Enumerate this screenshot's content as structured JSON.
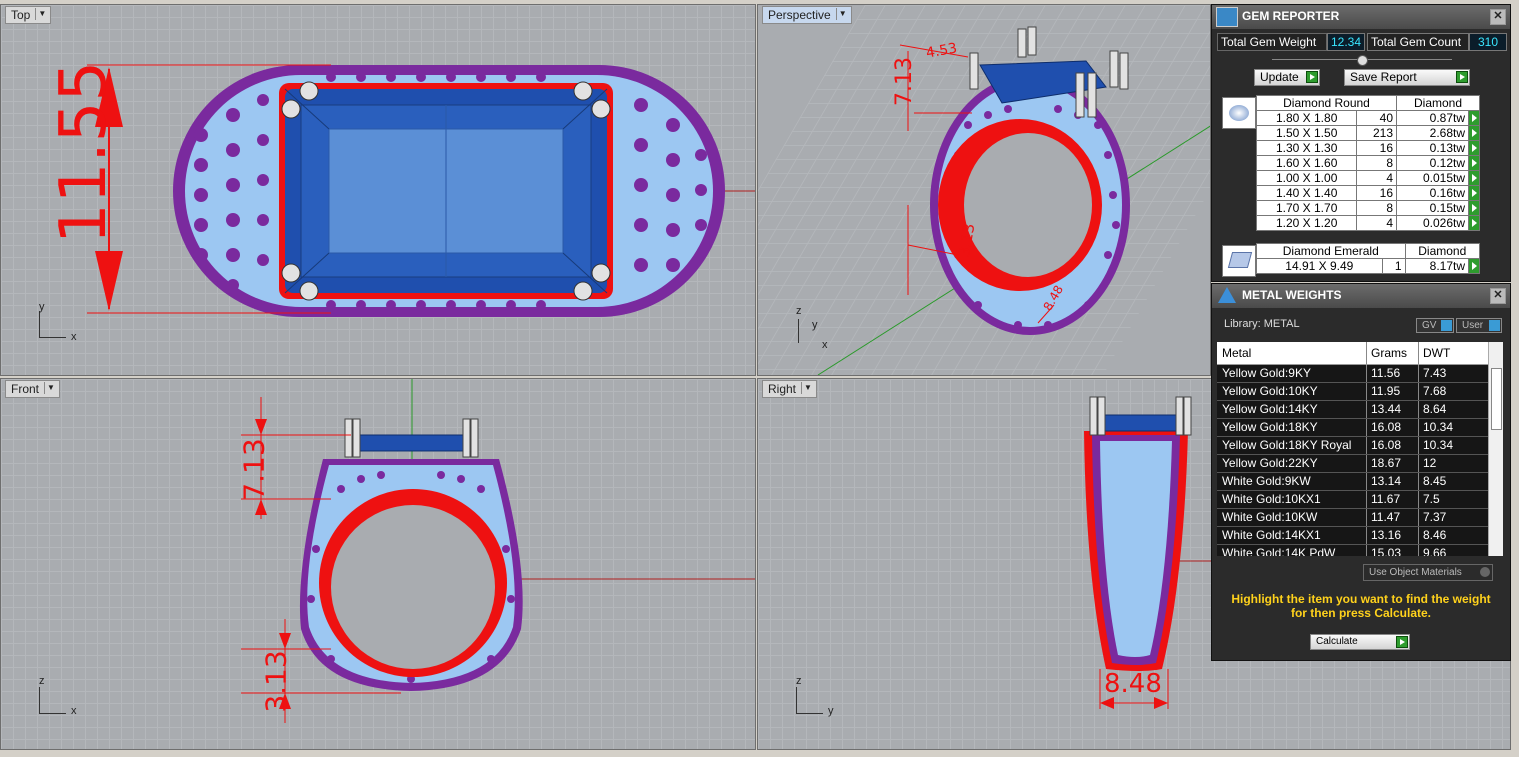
{
  "viewports": {
    "top": {
      "label": "Top",
      "axis_a": "y",
      "axis_b": "x",
      "dim_main": "11.55"
    },
    "perspective": {
      "label": "Perspective",
      "axis_a": "z",
      "axis_b": "y",
      "axis_c": "x",
      "dims": [
        "7.13",
        "4.53",
        "3.13",
        "8.48"
      ]
    },
    "front": {
      "label": "Front",
      "axis_a": "z",
      "axis_b": "x",
      "dim_top": "7.13",
      "dim_bottom": "3.13"
    },
    "right": {
      "label": "Right",
      "axis_a": "z",
      "axis_b": "y",
      "dim_width": "8.48"
    }
  },
  "gem_reporter": {
    "title": "GEM REPORTER",
    "close": "✕",
    "total_weight_label": "Total Gem Weight",
    "total_weight_value": "12.34",
    "total_count_label": "Total Gem Count",
    "total_count_value": "310",
    "update_label": "Update",
    "save_report_label": "Save Report",
    "round_group": {
      "name": "Diamond Round",
      "material": "Diamond",
      "rows": [
        {
          "size": "1.80 X 1.80",
          "count": "40",
          "weight": "0.87tw"
        },
        {
          "size": "1.50 X 1.50",
          "count": "213",
          "weight": "2.68tw"
        },
        {
          "size": "1.30 X 1.30",
          "count": "16",
          "weight": "0.13tw"
        },
        {
          "size": "1.60 X 1.60",
          "count": "8",
          "weight": "0.12tw"
        },
        {
          "size": "1.00 X 1.00",
          "count": "4",
          "weight": "0.015tw"
        },
        {
          "size": "1.40 X 1.40",
          "count": "16",
          "weight": "0.16tw"
        },
        {
          "size": "1.70 X 1.70",
          "count": "8",
          "weight": "0.15tw"
        },
        {
          "size": "1.20 X 1.20",
          "count": "4",
          "weight": "0.026tw"
        }
      ]
    },
    "emerald_group": {
      "name": "Diamond Emerald",
      "material": "Diamond",
      "rows": [
        {
          "size": "14.91 X 9.49",
          "count": "1",
          "weight": "8.17tw"
        }
      ]
    }
  },
  "metal_weights": {
    "title": "METAL WEIGHTS",
    "close": "✕",
    "library_label": "Library: METAL",
    "gv_label": "GV",
    "user_label": "User",
    "col_metal": "Metal",
    "col_grams": "Grams",
    "col_dwt": "DWT",
    "rows": [
      {
        "metal": "Yellow Gold:9KY",
        "grams": "11.56",
        "dwt": "7.43"
      },
      {
        "metal": "Yellow Gold:10KY",
        "grams": "11.95",
        "dwt": "7.68"
      },
      {
        "metal": "Yellow Gold:14KY",
        "grams": "13.44",
        "dwt": "8.64"
      },
      {
        "metal": "Yellow Gold:18KY",
        "grams": "16.08",
        "dwt": "10.34"
      },
      {
        "metal": "Yellow Gold:18KY Royal",
        "grams": "16.08",
        "dwt": "10.34"
      },
      {
        "metal": "Yellow Gold:22KY",
        "grams": "18.67",
        "dwt": "12"
      },
      {
        "metal": "White Gold:9KW",
        "grams": "13.14",
        "dwt": "8.45"
      },
      {
        "metal": "White Gold:10KX1",
        "grams": "11.67",
        "dwt": "7.5"
      },
      {
        "metal": "White Gold:10KW",
        "grams": "11.47",
        "dwt": "7.37"
      },
      {
        "metal": "White Gold:14KX1",
        "grams": "13.16",
        "dwt": "8.46"
      },
      {
        "metal": "White Gold:14K PdW",
        "grams": "15.03",
        "dwt": "9.66"
      }
    ],
    "use_object_materials": "Use Object Materials",
    "hint": "Highlight the item you want to find the weight for then press Calculate.",
    "calculate_label": "Calculate"
  },
  "colors": {
    "accent_red": "#ee1111",
    "gem_blue": "#1f4fae",
    "pave_purple": "#7a2a9e",
    "hint_yellow": "#ffd21c"
  }
}
